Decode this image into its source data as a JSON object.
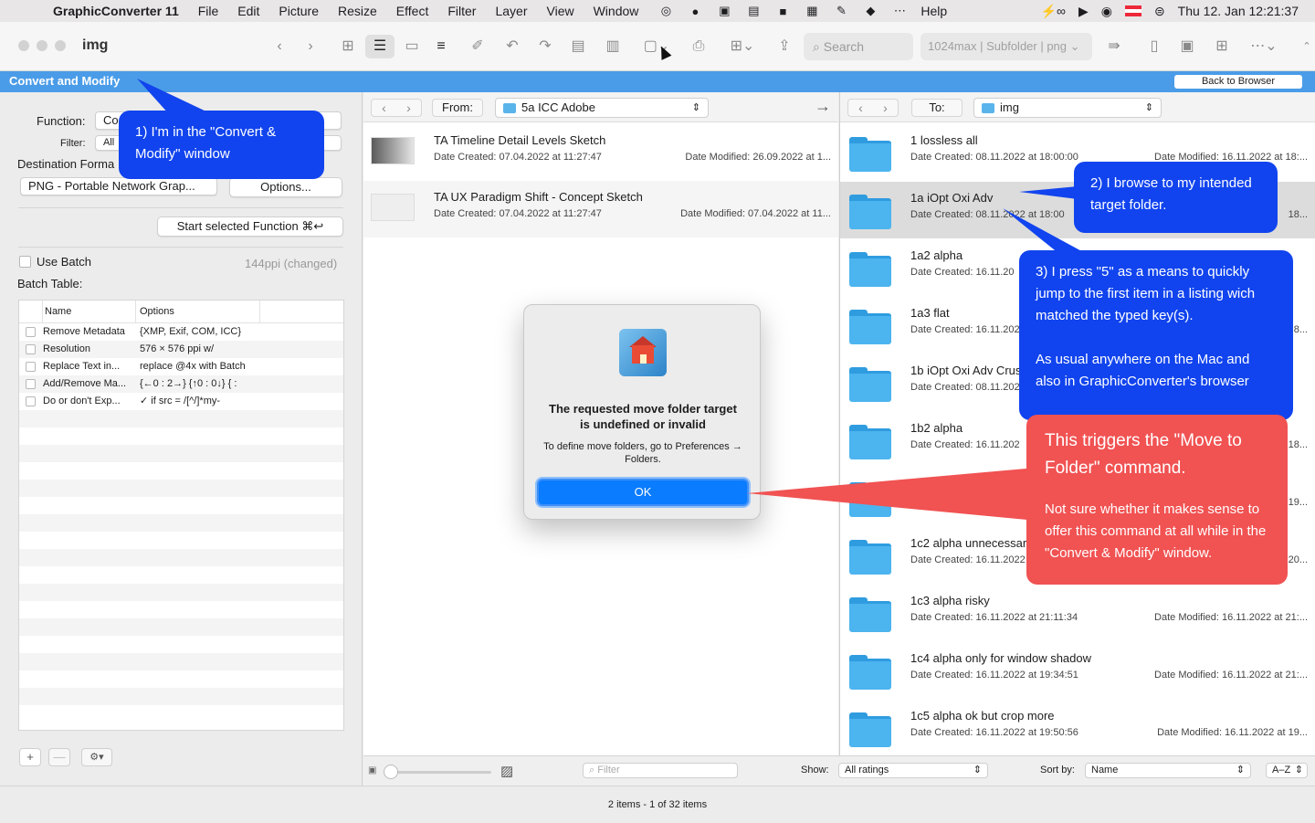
{
  "menubar": {
    "app": "GraphicConverter 11",
    "items": [
      "File",
      "Edit",
      "Picture",
      "Resize",
      "Effect",
      "Filter",
      "Layer",
      "View",
      "Window"
    ],
    "help": "Help",
    "battery": "⚡∞",
    "datetime": "Thu 12. Jan  12:21:37"
  },
  "window": {
    "title": "img",
    "search_placeholder": "Search",
    "preset": "1024max | Subfolder | png"
  },
  "convert_bar": {
    "title": "Convert and Modify",
    "back_button": "Back to Browser"
  },
  "left": {
    "function_label": "Function:",
    "function_value": "Co",
    "filter_label": "Filter:",
    "filter_value": "All",
    "dest_label": "Destination Forma",
    "format_value": "PNG - Portable Network Grap...",
    "options_button": "Options...",
    "start_button": "Start selected Function ⌘↩",
    "use_batch": "Use Batch",
    "ppi_note": "144ppi (changed)",
    "batch_table_label": "Batch Table:",
    "col_name": "Name",
    "col_options": "Options",
    "rows": [
      {
        "name": "Remove Metadata",
        "opt": "{XMP, Exif, COM, ICC}"
      },
      {
        "name": "Resolution",
        "opt": "576 × 576 ppi w/"
      },
      {
        "name": "Replace Text in...",
        "opt": "replace @4x with Batch"
      },
      {
        "name": "Add/Remove Ma...",
        "opt": "{←0 : 2→} {↑0 : 0↓} {  :"
      },
      {
        "name": "Do or don't Exp...",
        "opt": "✓ if src = /[^/]*my-"
      }
    ],
    "add": "+",
    "remove": "—",
    "action": "⚙︎▾"
  },
  "from": {
    "label": "From:",
    "path": "5a ICC Adobe",
    "items": [
      {
        "name": "TA Timeline Detail Levels Sketch",
        "created": "Date Created: 07.04.2022 at 11:27:47",
        "modified": "Date Modified: 26.09.2022 at 1..."
      },
      {
        "name": "TA UX Paradigm Shift - Concept Sketch",
        "created": "Date Created: 07.04.2022 at 11:27:47",
        "modified": "Date Modified: 07.04.2022 at 11..."
      }
    ]
  },
  "to": {
    "label": "To:",
    "path": "img",
    "items": [
      {
        "name": "1 lossless all",
        "created": "Date Created: 08.11.2022 at 18:00:00",
        "modified": "Date Modified: 16.11.2022 at 18:..."
      },
      {
        "name": "1a iOpt Oxi Adv",
        "created": "Date Created: 08.11.2022 at 18:00",
        "modified": "18..."
      },
      {
        "name": "1a2 alpha",
        "created": "Date Created: 16.11.20",
        "modified": ""
      },
      {
        "name": "1a3 flat",
        "created": "Date Created: 16.11.202",
        "modified": "8..."
      },
      {
        "name": "1b iOpt Oxi Adv Crus",
        "created": "Date Created: 08.11.202",
        "modified": ""
      },
      {
        "name": "1b2 alpha",
        "created": "Date Created: 16.11.202",
        "modified": "18..."
      },
      {
        "name": "",
        "created": "",
        "modified": "19..."
      },
      {
        "name": "1c2 alpha unnecessar",
        "created": "Date Created: 16.11.2022",
        "modified": "20..."
      },
      {
        "name": "1c3 alpha risky",
        "created": "Date Created: 16.11.2022 at 21:11:34",
        "modified": "Date Modified: 16.11.2022 at 21:..."
      },
      {
        "name": "1c4 alpha only for window shadow",
        "created": "Date Created: 16.11.2022 at 19:34:51",
        "modified": "Date Modified: 16.11.2022 at 21:..."
      },
      {
        "name": "1c5 alpha ok but crop more",
        "created": "Date Created: 16.11.2022 at 19:50:56",
        "modified": "Date Modified: 16.11.2022 at 19..."
      }
    ]
  },
  "bottom": {
    "filter_placeholder": "Filter",
    "show_label": "Show:",
    "show_value": "All ratings",
    "sort_label": "Sort by:",
    "sort_value": "Name",
    "order_value": "A–Z"
  },
  "status": "2 items - 1 of 32 items",
  "dialog": {
    "title": "The requested move folder target is undefined or invalid",
    "message": "To define move folders, go to Preferences → Folders.",
    "ok": "OK"
  },
  "callouts": {
    "c1": "1) I'm in the \"Convert & Modify\" window",
    "c2": "2) I browse to my intended target folder.",
    "c3a": "3) I press \"5\" as a means to quickly jump to the first item in a listing wich matched the typed key(s).",
    "c3b": "As usual anywhere on the Mac and also in GraphicConverter's browser",
    "c4a": "This triggers the \"Move to Folder\" command.",
    "c4b": "Not sure whether it makes sense to offer this command at all while in the \"Convert & Modify\" window."
  },
  "colors": {
    "callout_blue": "#1144ee",
    "callout_red": "#f15252",
    "accent": "#4a9ce8"
  }
}
